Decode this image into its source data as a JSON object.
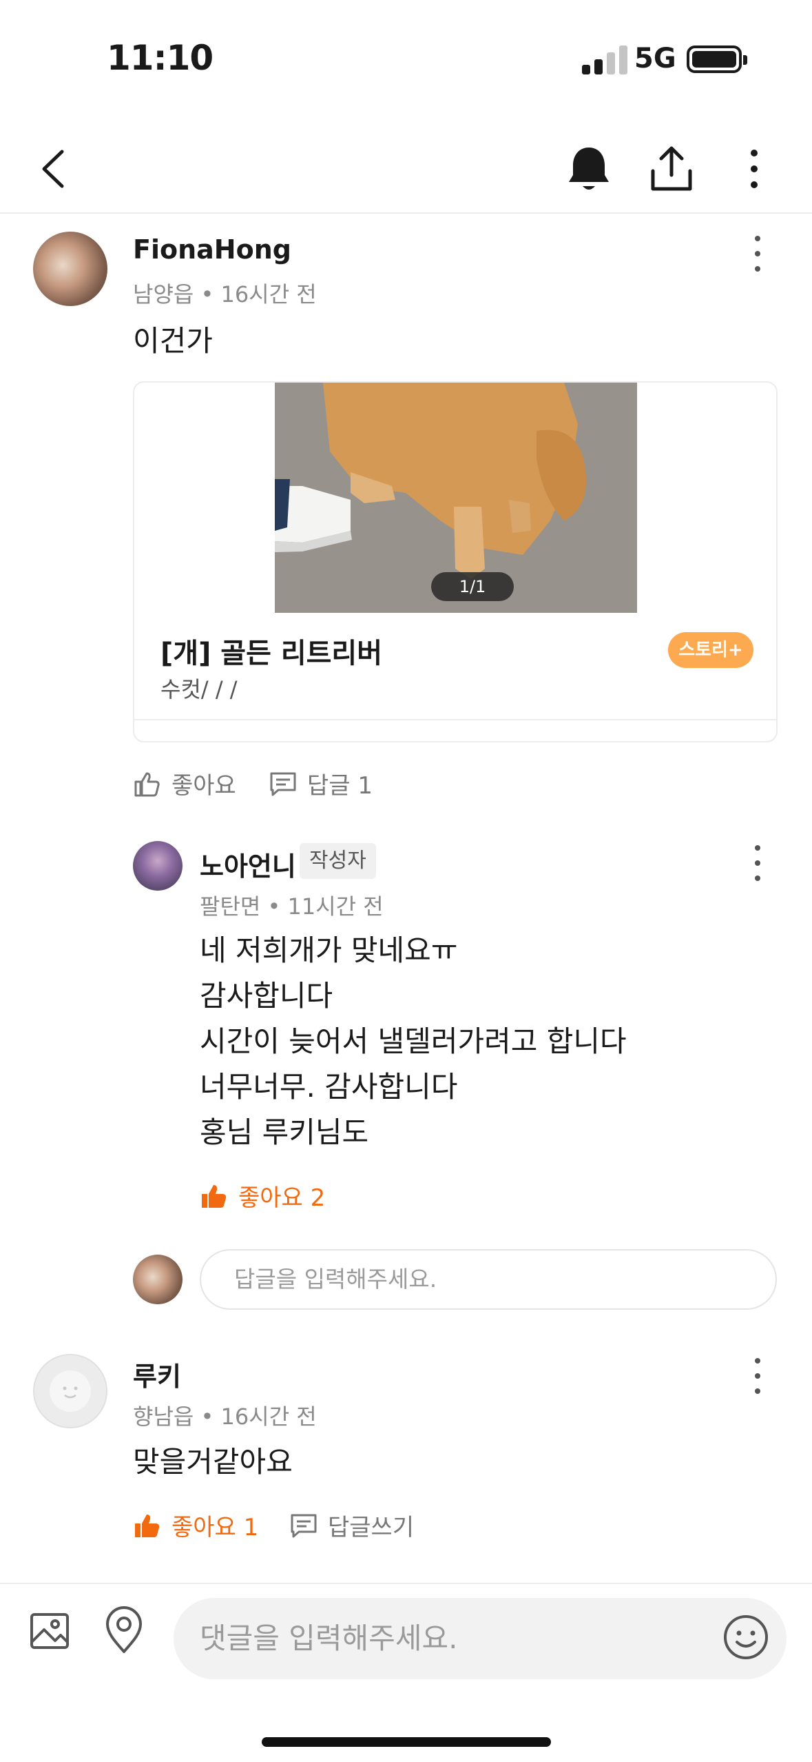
{
  "status_bar": {
    "time": "11:10",
    "network": "5G"
  },
  "nav": {
    "back_icon": "chevron-left-icon",
    "bell_icon": "bell-icon",
    "share_icon": "share-icon",
    "more_icon": "more-vertical-icon"
  },
  "comments": [
    {
      "author": "FionaHong",
      "meta": "남양읍 • 16시간 전",
      "text": "이건가",
      "card": {
        "photo_counter": "1/1",
        "title": "[개] 골든 리트리버",
        "subtitle": "수컷/ / /",
        "badge": "스토리+"
      },
      "like_label": "좋아요",
      "reply_label": "답글 1"
    },
    {
      "author": "노아언니",
      "author_badge": "작성자",
      "meta": "팔탄면 • 11시간 전",
      "lines": [
        "네 저희개가 맞네요ㅠ",
        "감사합니다",
        "시간이 늦어서 낼델러가려고 합니다",
        "너무너무. 감사합니다",
        "홍님 루키님도"
      ],
      "like_label": "좋아요 2",
      "reply_placeholder": "답글을 입력해주세요."
    },
    {
      "author": "루키",
      "meta": "향남읍 • 16시간 전",
      "text": "맞을거같아요",
      "like_label": "좋아요 1",
      "reply_label": "답글쓰기"
    }
  ],
  "bottom_bar": {
    "placeholder": "댓글을 입력해주세요."
  },
  "colors": {
    "accent": "#f26a10",
    "badge": "#fca94f"
  }
}
